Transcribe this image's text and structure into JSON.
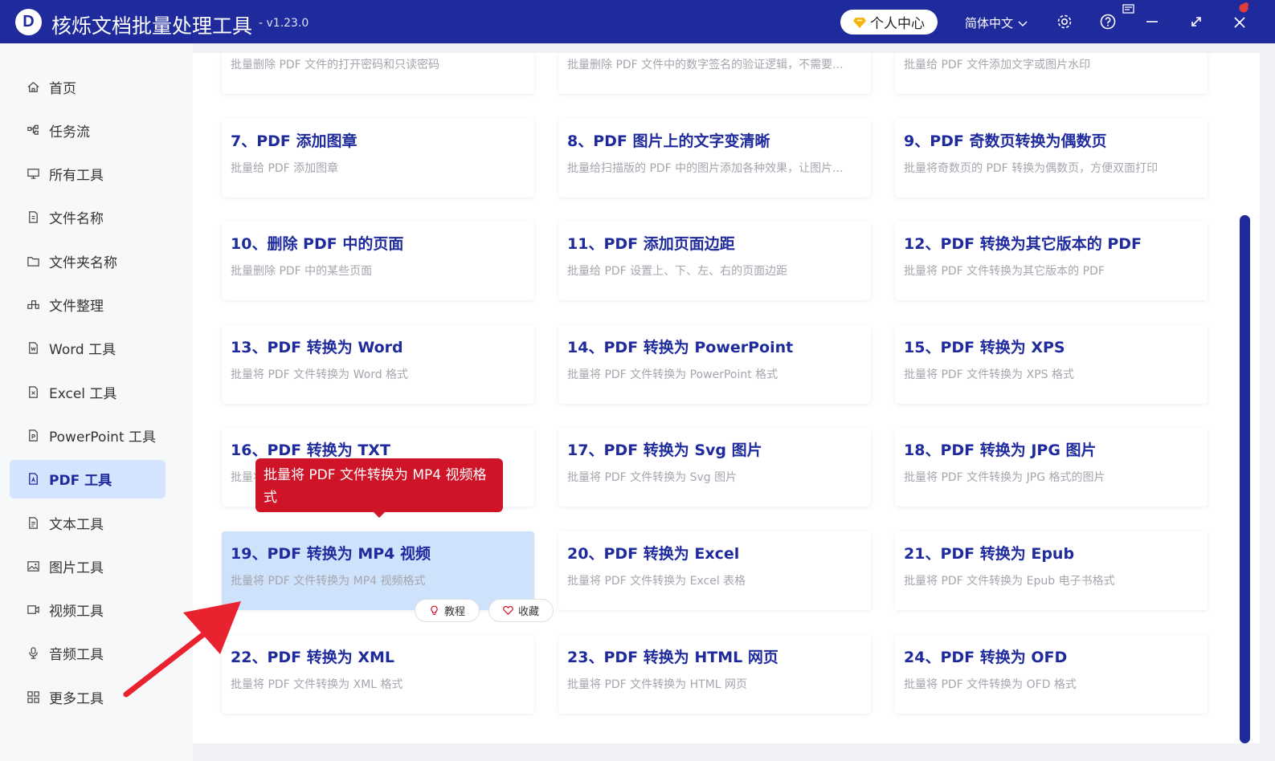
{
  "app": {
    "logo_letter": "D",
    "title": "核烁文档批量处理工具",
    "version": "- v1.23.0"
  },
  "titlebar": {
    "user_center_label": "个人中心",
    "language_label": "简体中文"
  },
  "sidebar": {
    "items": [
      {
        "label": "首页",
        "icon": "home-icon"
      },
      {
        "label": "任务流",
        "icon": "workflow-icon"
      },
      {
        "label": "所有工具",
        "icon": "monitor-icon"
      },
      {
        "label": "文件名称",
        "icon": "file-name-icon"
      },
      {
        "label": "文件夹名称",
        "icon": "folder-icon"
      },
      {
        "label": "文件整理",
        "icon": "organize-icon"
      },
      {
        "label": "Word 工具",
        "icon": "word-file-icon"
      },
      {
        "label": "Excel 工具",
        "icon": "excel-file-icon"
      },
      {
        "label": "PowerPoint 工具",
        "icon": "ppt-file-icon"
      },
      {
        "label": "PDF 工具",
        "icon": "pdf-file-icon",
        "active": true
      },
      {
        "label": "文本工具",
        "icon": "text-file-icon"
      },
      {
        "label": "图片工具",
        "icon": "image-icon"
      },
      {
        "label": "视频工具",
        "icon": "video-icon"
      },
      {
        "label": "音频工具",
        "icon": "microphone-icon"
      },
      {
        "label": "更多工具",
        "icon": "grid-icon"
      }
    ]
  },
  "cards": [
    {
      "title": "",
      "desc": "批量删除 PDF 文件的打开密码和只读密码"
    },
    {
      "title": "",
      "desc": "批量删除 PDF 文件中的数字签名的验证逻辑，不需要..."
    },
    {
      "title": "",
      "desc": "批量给 PDF 文件添加文字或图片水印"
    },
    {
      "title": "7、PDF 添加图章",
      "desc": "批量给 PDF 添加图章"
    },
    {
      "title": "8、PDF 图片上的文字变清晰",
      "desc": "批量给扫描版的 PDF 中的图片添加各种效果，让图片..."
    },
    {
      "title": "9、PDF 奇数页转换为偶数页",
      "desc": "批量将奇数页的 PDF 转换为偶数页，方便双面打印"
    },
    {
      "title": "10、删除 PDF 中的页面",
      "desc": "批量删除 PDF 中的某些页面"
    },
    {
      "title": "11、PDF 添加页面边距",
      "desc": "批量给 PDF 设置上、下、左、右的页面边距"
    },
    {
      "title": "12、PDF 转换为其它版本的 PDF",
      "desc": "批量将 PDF 文件转换为其它版本的 PDF"
    },
    {
      "title": "13、PDF 转换为 Word",
      "desc": "批量将 PDF 文件转换为 Word 格式"
    },
    {
      "title": "14、PDF 转换为 PowerPoint",
      "desc": "批量将 PDF 文件转换为 PowerPoint 格式"
    },
    {
      "title": "15、PDF 转换为 XPS",
      "desc": "批量将 PDF 文件转换为 XPS 格式"
    },
    {
      "title": "16、PDF 转换为 TXT",
      "desc": "批量将 PDF 文件转换为 TXT 格式"
    },
    {
      "title": "17、PDF 转换为 Svg 图片",
      "desc": "批量将 PDF 文件转换为 Svg 图片"
    },
    {
      "title": "18、PDF 转换为 JPG 图片",
      "desc": "批量将 PDF 文件转换为 JPG 格式的图片"
    },
    {
      "title": "19、PDF 转换为 MP4 视频",
      "desc": "批量将 PDF 文件转换为 MP4 视频格式",
      "active": true
    },
    {
      "title": "20、PDF 转换为 Excel",
      "desc": "批量将 PDF 文件转换为 Excel 表格"
    },
    {
      "title": "21、PDF 转换为 Epub",
      "desc": "批量将 PDF 文件转换为 Epub 电子书格式"
    },
    {
      "title": "22、PDF 转换为 XML",
      "desc": "批量将 PDF 文件转换为 XML 格式"
    },
    {
      "title": "23、PDF 转换为 HTML 网页",
      "desc": "批量将 PDF 文件转换为 HTML 网页"
    },
    {
      "title": "24、PDF 转换为 OFD",
      "desc": "批量将 PDF 文件转换为 OFD 格式"
    }
  ],
  "tooltip": {
    "text": "批量将 PDF 文件转换为 MP4 视频格式"
  },
  "card_actions": {
    "tutorial_label": "教程",
    "favorite_label": "收藏"
  },
  "colors": {
    "primary": "#1f2b9c",
    "active_bg": "#d4e4ff",
    "tooltip": "#d01428",
    "arrow": "#e8222e"
  }
}
